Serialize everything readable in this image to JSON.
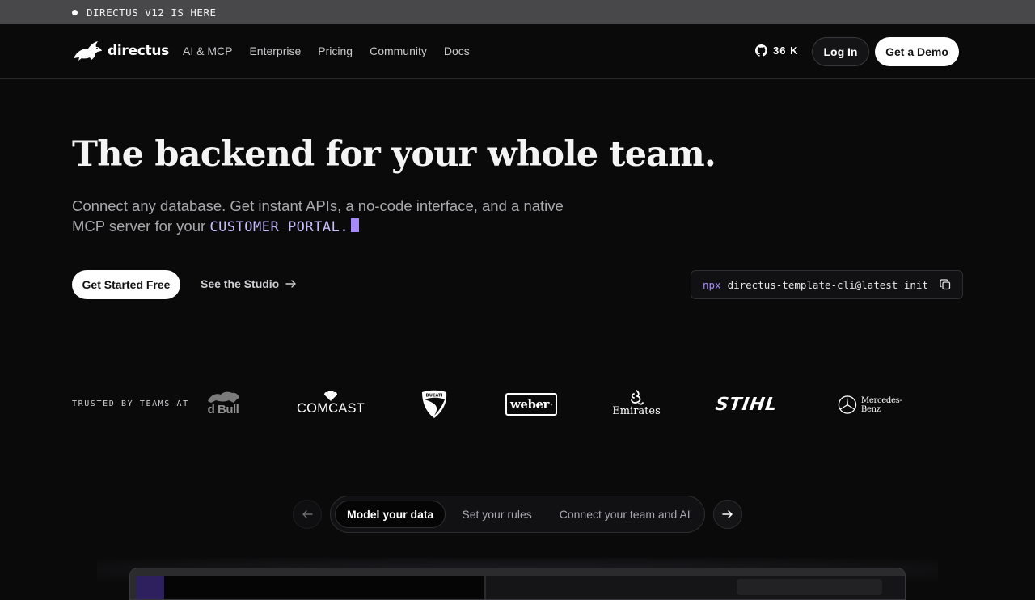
{
  "announcement": {
    "text": "DIRECTUS V12 IS HERE"
  },
  "nav": {
    "logo_text": "directus",
    "links": [
      "AI & MCP",
      "Enterprise",
      "Pricing",
      "Community",
      "Docs"
    ],
    "github_count": "36 K",
    "login_label": "Log In",
    "demo_label": "Get a Demo"
  },
  "hero": {
    "title": "The backend for your whole team.",
    "subtitle": "Connect any database. Get instant APIs, a no-code interface, and a native MCP server for your",
    "highlight": "CUSTOMER PORTAL.",
    "primary_cta": "Get Started Free",
    "secondary_cta": "See the Studio",
    "cli_prefix": "npx",
    "cli_command": "directus-template-cli@latest init"
  },
  "trusted": {
    "label": "TRUSTED BY TEAMS AT",
    "brands": [
      "d Bull",
      "COMCAST",
      "DUCATI",
      "weber",
      "Emirates",
      "STIHL",
      "Mercedes-Benz"
    ]
  },
  "tabs": {
    "items": [
      "Model your data",
      "Set your rules",
      "Connect your team and AI"
    ],
    "active_index": 0
  },
  "colors": {
    "accent": "#a78bfa",
    "background": "#0a0a0b",
    "announcement_bg": "#48484a"
  }
}
